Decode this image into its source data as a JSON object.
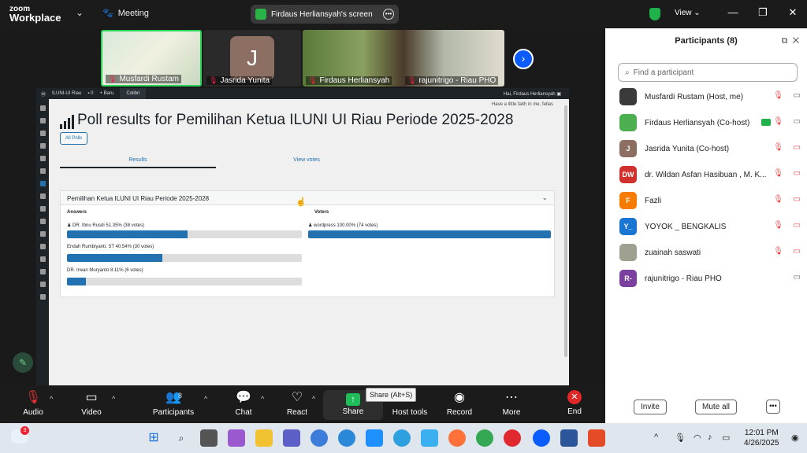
{
  "app": {
    "brand_line1": "zoom",
    "brand_line2": "Workplace",
    "meeting_label": "Meeting",
    "screen_label": "Firdaus Herliansyah's screen",
    "view_label": "View"
  },
  "thumbnails": [
    {
      "name": "Musfardi Rustam"
    },
    {
      "name": "Jasrida Yunita",
      "initial": "J"
    },
    {
      "name": "Firdaus Herliansyah"
    },
    {
      "name": "rajunitrigo - Riau PHO"
    }
  ],
  "wp": {
    "site": "ILUNI-UI Riau",
    "comments": "0",
    "new": "+ Baru",
    "plugin": "Colibri",
    "howdy": "Hai, Firdaus Herliansyah",
    "faith": "Have a little faith in me, fellas",
    "poll_title": "Poll results for Pemilihan Ketua ILUNI UI Riau Periode 2025-2028",
    "all_polls": "All Polls",
    "tab_results": "Results",
    "tab_votes": "View votes",
    "panel_title": "Pemilihan Ketua ILUNI UI Riau Periode 2025-2028",
    "answers_head": "Answers",
    "voters_head": "Voters"
  },
  "chart_data": {
    "type": "bar",
    "categories": [
      "DR. Ibnu Rusdi",
      "Endah Rumbiyanti, ST",
      "DR. Irwan Muryanto"
    ],
    "values": [
      51.35,
      40.54,
      8.11
    ],
    "votes": [
      38,
      30,
      6
    ],
    "labels": [
      "DR. Ibnu Rusdi 51.35% (38 votes)",
      "Endah Rumbiyanti, ST 40.54% (30 votes)",
      "DR. Irwan Muryanto 8.11% (6 votes)"
    ],
    "voters": [
      {
        "label": "wordpress 100.00% (74 votes)",
        "value": 100
      }
    ],
    "ylim": [
      0,
      100
    ]
  },
  "toolbar": {
    "audio": "Audio",
    "video": "Video",
    "participants": "Participants",
    "participants_count": "8",
    "chat": "Chat",
    "react": "React",
    "share": "Share",
    "host_tools": "Host tools",
    "record": "Record",
    "more": "More",
    "end": "End",
    "share_tooltip": "Share (Alt+S)"
  },
  "participants": {
    "title": "Participants (8)",
    "search_placeholder": "Find a participant",
    "items": [
      {
        "name": "Musfardi Rustam (Host, me)",
        "initials": "",
        "color": "#3a3a3a"
      },
      {
        "name": "Firdaus Herliansyah (Co-host)",
        "initials": "",
        "color": "#4caf50"
      },
      {
        "name": "Jasrida Yunita (Co-host)",
        "initials": "J",
        "color": "#8d6e63"
      },
      {
        "name": "dr. Wildan Asfan Hasibuan , M. K...",
        "initials": "DW",
        "color": "#d0312d"
      },
      {
        "name": "Fazli",
        "initials": "F",
        "color": "#f57c00"
      },
      {
        "name": "YOYOK _ BENGKALIS",
        "initials": "Y_",
        "color": "#1976d2"
      },
      {
        "name": "zuainah saswati",
        "initials": "",
        "color": "#a0a090"
      },
      {
        "name": "rajunitrigo - Riau PHO",
        "initials": "R-",
        "color": "#7b3fa0"
      }
    ],
    "invite": "Invite",
    "mute_all": "Mute all"
  },
  "taskbar": {
    "time": "12:01 PM",
    "date": "4/26/2025",
    "weather_badge": "3"
  }
}
